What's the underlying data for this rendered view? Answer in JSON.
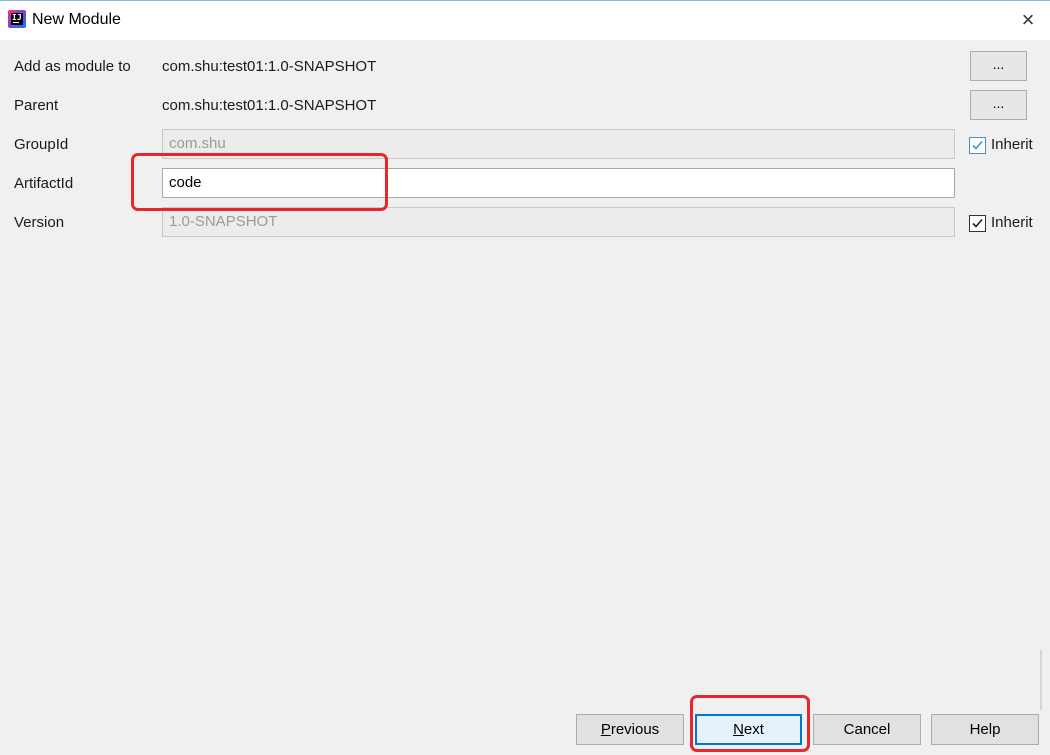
{
  "window": {
    "title": "New Module",
    "close_glyph": "×"
  },
  "form": {
    "add_as_module_to": {
      "label": "Add as module to",
      "value": "com.shu:test01:1.0-SNAPSHOT",
      "button": "..."
    },
    "parent": {
      "label": "Parent",
      "value": "com.shu:test01:1.0-SNAPSHOT",
      "button": "..."
    },
    "group_id": {
      "label": "GroupId",
      "value": "com.shu",
      "inherit_label": "Inherit",
      "inherit_checked": true
    },
    "artifact_id": {
      "label": "ArtifactId",
      "value": "code"
    },
    "version": {
      "label": "Version",
      "value": "1.0-SNAPSHOT",
      "inherit_label": "Inherit",
      "inherit_checked": true
    }
  },
  "footer": {
    "previous": {
      "mnemonic": "P",
      "rest": "revious"
    },
    "next": {
      "mnemonic": "N",
      "rest": "ext"
    },
    "cancel": "Cancel",
    "help": "Help"
  },
  "colors": {
    "highlight": "#e8262b",
    "focus_blue": "#0078d7"
  }
}
